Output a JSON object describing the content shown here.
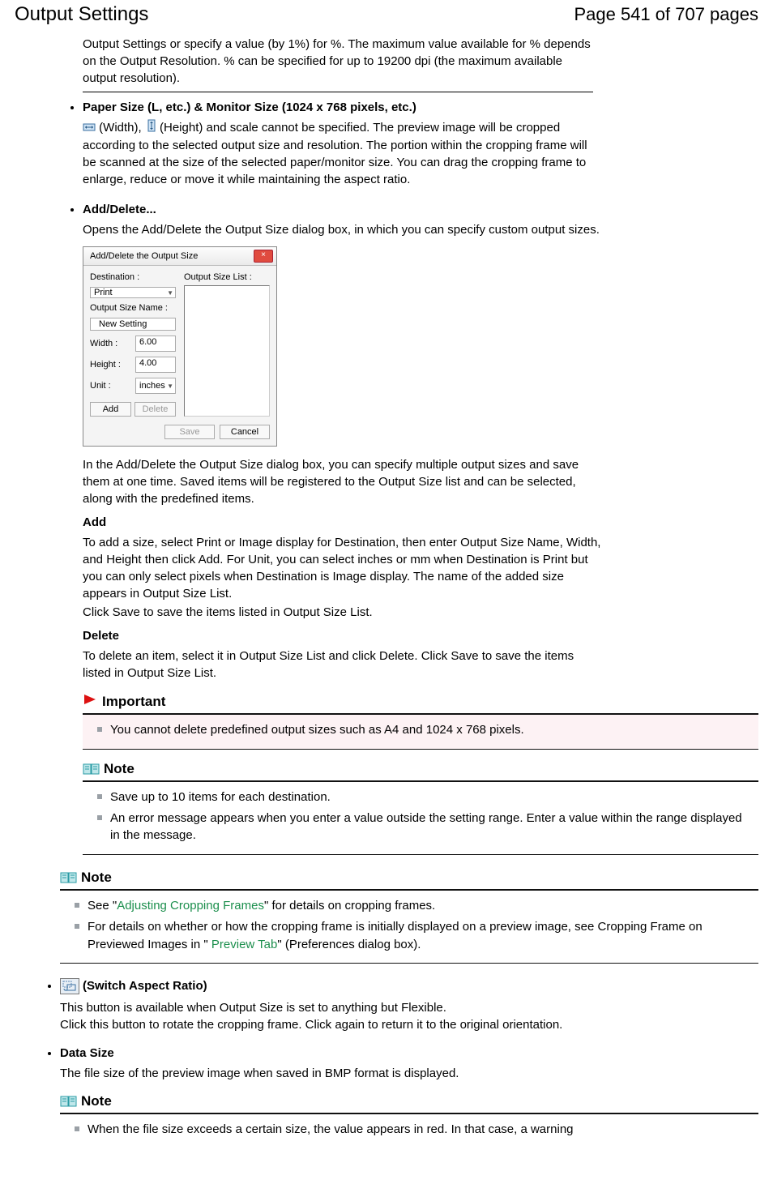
{
  "header": {
    "title": "Output Settings",
    "page": "Page 541 of 707 pages"
  },
  "intro": "Output Settings or specify a value (by 1%) for %. The maximum value available for % depends on the Output Resolution. % can be specified for up to 19200 dpi (the maximum available output resolution).",
  "paper": {
    "heading": "Paper Size (L, etc.) & Monitor Size (1024 x 768 pixels, etc.)",
    "pre": " (Width), ",
    "mid": " (Height) and scale cannot be specified. The preview image will be cropped according to the selected output size and resolution. The portion within the cropping frame will be scanned at the size of the selected paper/monitor size. You can drag the cropping frame to enlarge, reduce or move it while maintaining the aspect ratio."
  },
  "adddel": {
    "heading": "Add/Delete...",
    "intro": "Opens the Add/Delete the Output Size dialog box, in which you can specify custom output sizes.",
    "after_dialog": "In the Add/Delete the Output Size dialog box, you can specify multiple output sizes and save them at one time. Saved items will be registered to the Output Size list and can be selected, along with the predefined items.",
    "add_h": "Add",
    "add_p1": "To add a size, select Print or Image display for Destination, then enter Output Size Name, Width, and Height then click Add. For Unit, you can select inches or mm when Destination is Print but you can only select pixels when Destination is Image display. The name of the added size appears in Output Size List.",
    "add_p2": "Click Save to save the items listed in Output Size List.",
    "del_h": "Delete",
    "del_p": "To delete an item, select it in Output Size List and click Delete. Click Save to save the items listed in Output Size List."
  },
  "dialog": {
    "title": "Add/Delete the Output Size",
    "dest_label": "Destination :",
    "dest_value": "Print",
    "name_label": "Output Size Name :",
    "name_value": "New Setting",
    "width_label": "Width :",
    "width_value": "6.00",
    "height_label": "Height :",
    "height_value": "4.00",
    "unit_label": "Unit :",
    "unit_value": "inches",
    "add_btn": "Add",
    "delete_btn": "Delete",
    "list_label": "Output Size List :",
    "save_btn": "Save",
    "cancel_btn": "Cancel"
  },
  "important": {
    "label": "Important",
    "items": [
      "You cannot delete predefined output sizes such as A4 and 1024 x 768 pixels."
    ]
  },
  "note1": {
    "label": "Note",
    "items": [
      "Save up to 10 items for each destination.",
      "An error message appears when you enter a value outside the setting range. Enter a value within the range displayed in the message."
    ]
  },
  "note2": {
    "label": "Note",
    "pre1": "See \"",
    "link1": "Adjusting Cropping Frames",
    "post1": "\" for details on cropping frames.",
    "pre2": "For details on whether or how the cropping frame is initially displayed on a preview image, see Cropping Frame on Previewed Images in \" ",
    "link2": "Preview Tab",
    "post2": "\" (Preferences dialog box)."
  },
  "switch": {
    "heading": "(Switch Aspect Ratio)",
    "p1": "This button is available when Output Size is set to anything but Flexible.",
    "p2": "Click this button to rotate the cropping frame. Click again to return it to the original orientation."
  },
  "datasize": {
    "heading": "Data Size",
    "p": "The file size of the preview image when saved in BMP format is displayed."
  },
  "note3": {
    "label": "Note",
    "item": "When the file size exceeds a certain size, the value appears in red. In that case, a warning"
  }
}
